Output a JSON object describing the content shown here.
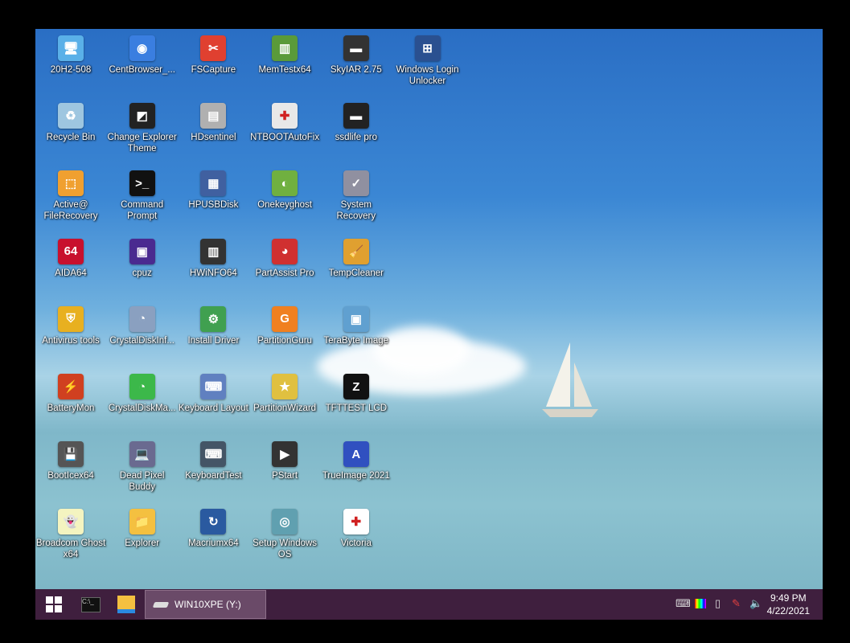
{
  "desktop": {
    "columns": [
      [
        "20H2-508",
        "Recycle Bin",
        "Active@ FileRecovery",
        "AIDA64",
        "Antivirus tools",
        "BatteryMon",
        "BootIcex64",
        "Broadcom Ghost x64"
      ],
      [
        "CentBrowser_...",
        "Change Explorer Theme",
        "Command Prompt",
        "cpuz",
        "CrystalDiskInf...",
        "CrystalDiskMa...",
        "Dead Pixel Buddy",
        "Explorer"
      ],
      [
        "FSCapture",
        "HDsentinel",
        "HPUSBDisk",
        "HWiNFO64",
        "Install Driver",
        "Keyboard Layout",
        "KeyboardTest",
        "Macriumx64"
      ],
      [
        "MemTestx64",
        "NTBOOTAutoFix",
        "Onekeyghost",
        "PartAssist Pro",
        "PartitionGuru",
        "PartitionWizard",
        "PStart",
        "Setup Windows OS"
      ],
      [
        "SkyIAR 2.75",
        "ssdlife pro",
        "System Recovery",
        "TempCleaner",
        "TeraByte Image",
        "TFTTEST LCD",
        "TrueImage 2021",
        "Victoria"
      ],
      [
        "Windows Login Unlocker"
      ]
    ],
    "icon_colors": [
      [
        "#5ab0e8",
        "#9ec6e0",
        "#f0a030",
        "#c8102e",
        "#e8b020",
        "#d04020",
        "#555555",
        "#f4f4c0"
      ],
      [
        "#3a7ee0",
        "#222222",
        "#111111",
        "#4a2a90",
        "#8aa0c0",
        "#3cb84a",
        "#6a6a90",
        "#f4c040"
      ],
      [
        "#e04030",
        "#b0b0b0",
        "#4060a0",
        "#333333",
        "#40a050",
        "#6080c0",
        "#445566",
        "#2a5aa0"
      ],
      [
        "#5a9a3a",
        "#e8e8e8",
        "#70b040",
        "#d03030",
        "#f08020",
        "#e0c040",
        "#333333",
        "#60a0b0"
      ],
      [
        "#333333",
        "#222222",
        "#9090a0",
        "#e0a030",
        "#60a0d0",
        "#111111",
        "#3050c0",
        "#ffffff"
      ],
      [
        "#2a5090"
      ]
    ],
    "icon_glyphs": [
      [
        "🖥",
        "♻",
        "⬚",
        "64",
        "⛨",
        "⚡",
        "💾",
        "👻"
      ],
      [
        "◉",
        "◩",
        ">_",
        "▣",
        "◔",
        "◔",
        "💻",
        "📁"
      ],
      [
        "✂",
        "▤",
        "▦",
        "▥",
        "⚙",
        "⌨",
        "⌨",
        "↻"
      ],
      [
        "▥",
        "✚",
        "◐",
        "◕",
        "G",
        "★",
        "▶",
        "◎"
      ],
      [
        "▬",
        "▬",
        "✓",
        "🧹",
        "▣",
        "Z",
        "A",
        "✚"
      ],
      [
        "⊞"
      ]
    ]
  },
  "taskbar": {
    "start": "Start",
    "cmd": "Command Prompt",
    "explorer": "File Explorer",
    "drive_label": "WIN10XPE (Y:)"
  },
  "tray": {
    "time": "9:49 PM",
    "date": "4/22/2021"
  }
}
